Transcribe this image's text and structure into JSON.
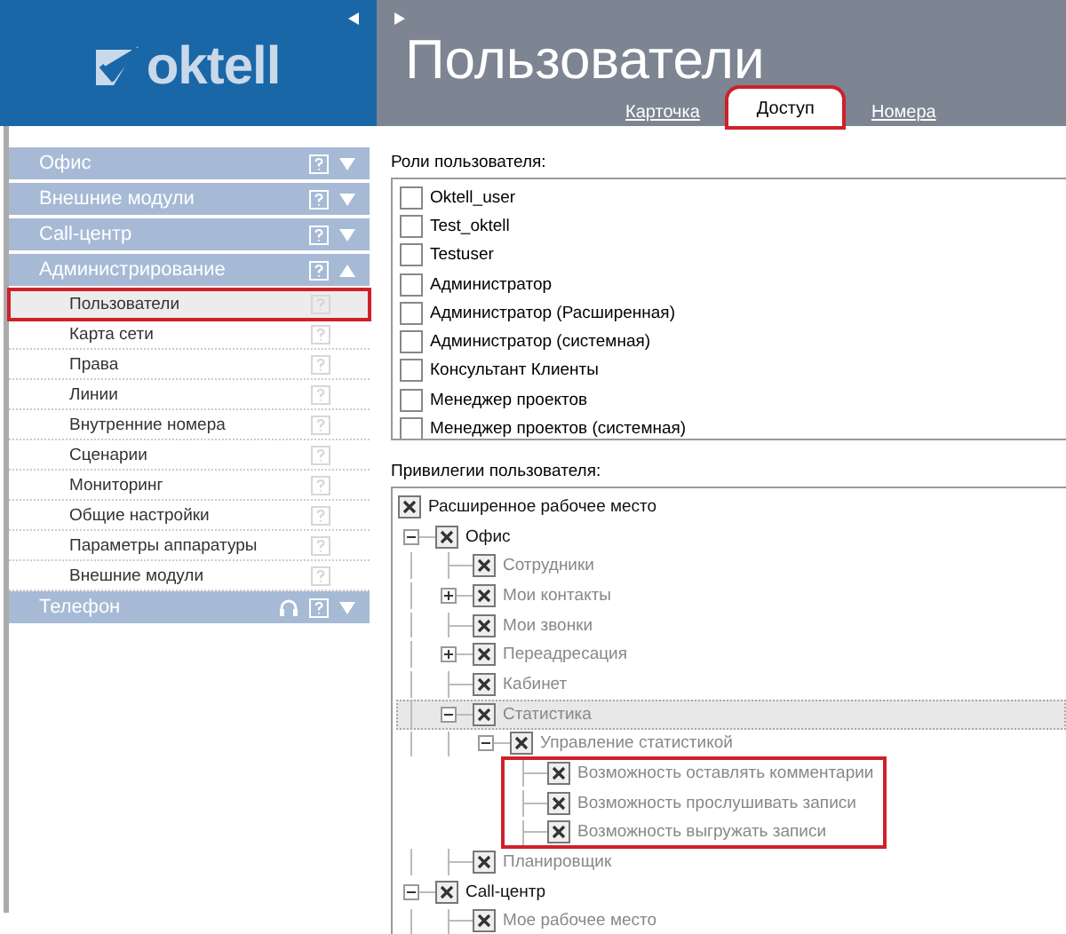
{
  "header": {
    "logo": "oktell",
    "title": "Пользователи",
    "tabs": [
      {
        "label": "Карточка",
        "selected": false,
        "annotated": false
      },
      {
        "label": "Доступ",
        "selected": true,
        "annotated": true
      },
      {
        "label": "Номера",
        "selected": false,
        "annotated": false
      }
    ]
  },
  "sidebar": {
    "sections": [
      {
        "title": "Офис",
        "expanded": false
      },
      {
        "title": "Внешние модули",
        "expanded": false
      },
      {
        "title": "Call-центр",
        "expanded": false
      },
      {
        "title": "Администрирование",
        "expanded": true,
        "items": [
          {
            "label": "Пользователи",
            "selected": true,
            "annotated": true
          },
          {
            "label": "Карта сети",
            "selected": false,
            "annotated": false
          },
          {
            "label": "Права",
            "selected": false,
            "annotated": false
          },
          {
            "label": "Линии",
            "selected": false,
            "annotated": false
          },
          {
            "label": "Внутренние номера",
            "selected": false,
            "annotated": false
          },
          {
            "label": "Сценарии",
            "selected": false,
            "annotated": false
          },
          {
            "label": "Мониторинг",
            "selected": false,
            "annotated": false
          },
          {
            "label": "Общие настройки",
            "selected": false,
            "annotated": false
          },
          {
            "label": "Параметры аппаратуры",
            "selected": false,
            "annotated": false
          },
          {
            "label": "Внешние модули",
            "selected": false,
            "annotated": false
          }
        ]
      },
      {
        "title": "Телефон",
        "expanded": false,
        "headset": true
      }
    ]
  },
  "roles": {
    "label": "Роли пользователя:",
    "items": [
      {
        "label": "Oktell_user",
        "checked": false
      },
      {
        "label": "Test_oktell",
        "checked": false
      },
      {
        "label": "Testuser",
        "checked": false
      },
      {
        "label": "Администратор",
        "checked": false
      },
      {
        "label": "Администратор (Расширенная)",
        "checked": false
      },
      {
        "label": "Администратор (системная)",
        "checked": false
      },
      {
        "label": "Консультант Клиенты",
        "checked": false
      },
      {
        "label": "Менеджер проектов",
        "checked": false
      },
      {
        "label": "Менеджер проектов (системная)",
        "checked": false
      }
    ]
  },
  "privileges": {
    "label": "Привилегии пользователя:",
    "tree": [
      {
        "label": "Расширенное рабочее место",
        "checked": true,
        "disabled": false,
        "selected": false
      },
      {
        "label": "Офис",
        "checked": true,
        "disabled": false,
        "selected": false,
        "expanded": true,
        "children": [
          {
            "label": "Сотрудники",
            "checked": true,
            "disabled": true,
            "selected": false
          },
          {
            "label": "Мои контакты",
            "checked": true,
            "disabled": true,
            "selected": false,
            "expanded": false
          },
          {
            "label": "Мои звонки",
            "checked": true,
            "disabled": true,
            "selected": false
          },
          {
            "label": "Переадресация",
            "checked": true,
            "disabled": true,
            "selected": false,
            "expanded": false
          },
          {
            "label": "Кабинет",
            "checked": true,
            "disabled": true,
            "selected": false
          },
          {
            "label": "Статистика",
            "checked": true,
            "disabled": true,
            "selected": true,
            "expanded": true,
            "children": [
              {
                "label": "Управление статистикой",
                "checked": true,
                "disabled": true,
                "selected": false,
                "expanded": true,
                "children_annotated": true,
                "children": [
                  {
                    "label": "Возможность оставлять комментарии",
                    "checked": true,
                    "disabled": true,
                    "selected": false
                  },
                  {
                    "label": "Возможность прослушивать записи",
                    "checked": true,
                    "disabled": true,
                    "selected": false
                  },
                  {
                    "label": "Возможность выгружать записи",
                    "checked": true,
                    "disabled": true,
                    "selected": false
                  }
                ]
              }
            ]
          },
          {
            "label": "Планировщик",
            "checked": true,
            "disabled": true,
            "selected": false
          }
        ]
      },
      {
        "label": "Call-центр",
        "checked": true,
        "disabled": false,
        "selected": false,
        "expanded": true,
        "children": [
          {
            "label": "Мое рабочее место",
            "checked": true,
            "disabled": true,
            "selected": false
          }
        ]
      }
    ]
  }
}
